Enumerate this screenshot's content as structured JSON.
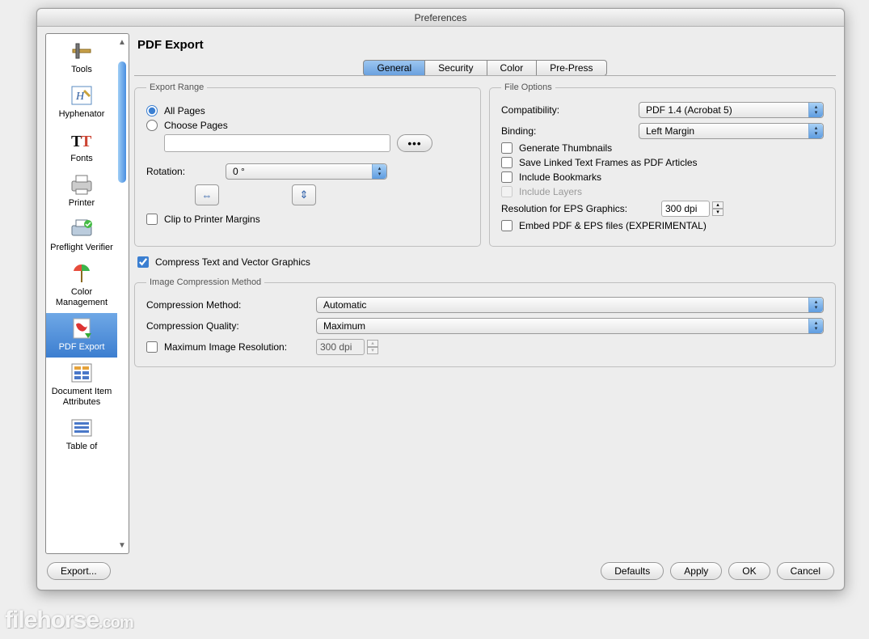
{
  "window": {
    "title": "Preferences"
  },
  "sidebar": {
    "items": [
      {
        "label": "Tools"
      },
      {
        "label": "Hyphenator"
      },
      {
        "label": "Fonts"
      },
      {
        "label": "Printer"
      },
      {
        "label": "Preflight Verifier"
      },
      {
        "label": "Color Management"
      },
      {
        "label": "PDF Export"
      },
      {
        "label": "Document Item Attributes"
      },
      {
        "label": "Table of"
      }
    ],
    "selected_index": 6
  },
  "panel": {
    "heading": "PDF Export",
    "tabs": [
      "General",
      "Security",
      "Color",
      "Pre-Press"
    ],
    "active_tab": 0,
    "export_range": {
      "legend": "Export Range",
      "all_pages_label": "All Pages",
      "choose_pages_label": "Choose Pages",
      "selected": "all",
      "pages_value": "",
      "rotation_label": "Rotation:",
      "rotation_value": "0 °",
      "clip_label": "Clip to Printer Margins",
      "clip_checked": false
    },
    "file_options": {
      "legend": "File Options",
      "compatibility_label": "Compatibility:",
      "compatibility_value": "PDF 1.4 (Acrobat 5)",
      "binding_label": "Binding:",
      "binding_value": "Left Margin",
      "gen_thumbs_label": "Generate Thumbnails",
      "gen_thumbs_checked": false,
      "save_linked_label": "Save Linked Text Frames as PDF Articles",
      "save_linked_checked": false,
      "bookmarks_label": "Include Bookmarks",
      "bookmarks_checked": false,
      "layers_label": "Include Layers",
      "layers_checked": false,
      "layers_disabled": true,
      "eps_res_label": "Resolution for EPS Graphics:",
      "eps_res_value": "300 dpi",
      "embed_label": "Embed PDF & EPS files (EXPERIMENTAL)",
      "embed_checked": false
    },
    "compress": {
      "compress_text_label": "Compress Text and Vector Graphics",
      "compress_text_checked": true,
      "legend": "Image Compression Method",
      "method_label": "Compression Method:",
      "method_value": "Automatic",
      "quality_label": "Compression Quality:",
      "quality_value": "Maximum",
      "max_res_label": "Maximum Image Resolution:",
      "max_res_checked": false,
      "max_res_value": "300 dpi"
    }
  },
  "footer": {
    "export_label": "Export...",
    "defaults_label": "Defaults",
    "apply_label": "Apply",
    "ok_label": "OK",
    "cancel_label": "Cancel"
  },
  "watermark": {
    "text": "filehorse",
    "suffix": ".com"
  }
}
